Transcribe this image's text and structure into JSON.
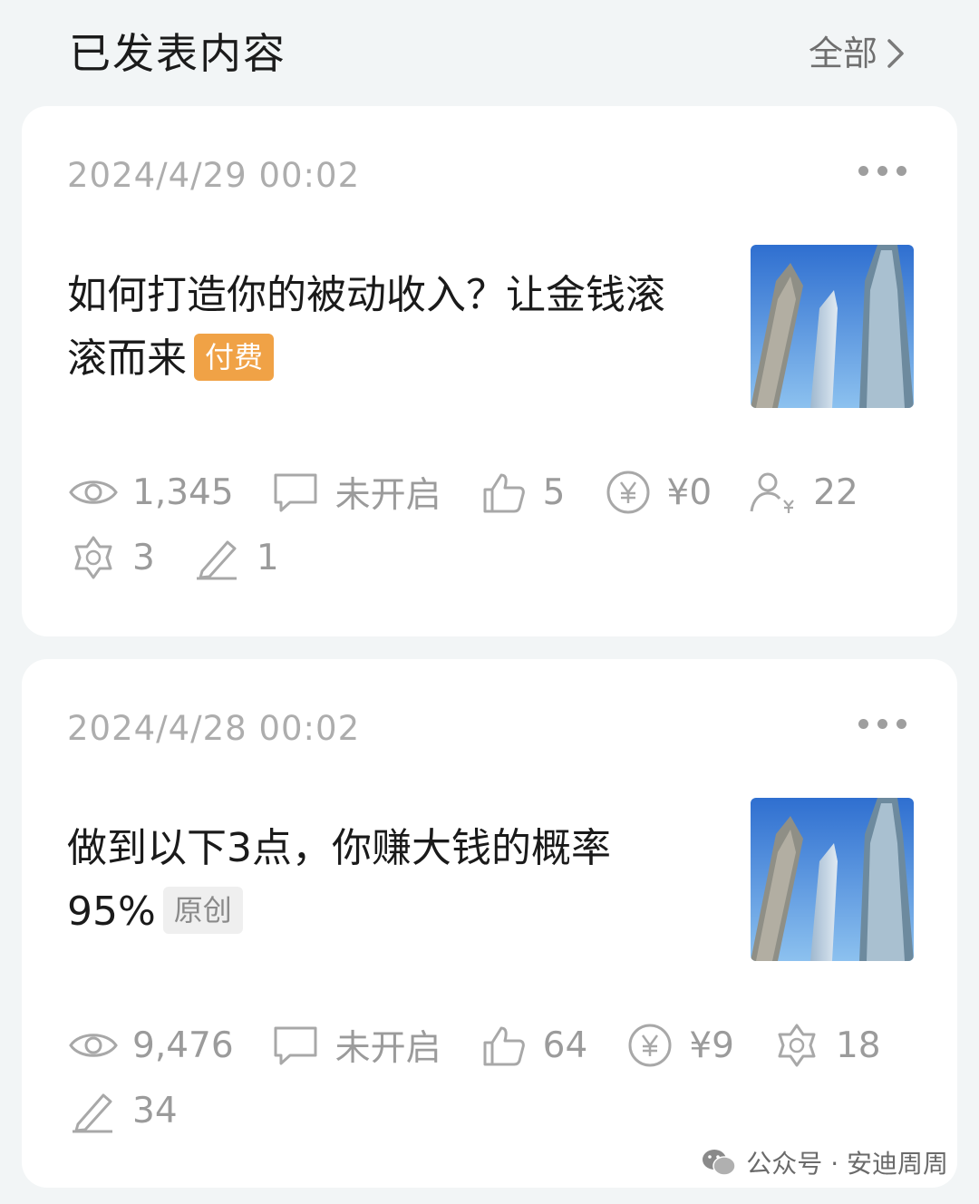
{
  "header": {
    "title": "已发表内容",
    "all_label": "全部"
  },
  "posts": [
    {
      "timestamp": "2024/4/29 00:02",
      "title": "如何打造你的被动收入？让金钱滚滚而来",
      "tag": "付费",
      "thumbnail_icon": "skyscraper-photo",
      "stats": {
        "views": "1,345",
        "comments": "未开启",
        "likes": "5",
        "appreciation": "¥0",
        "paid_users": "22",
        "shares": "3",
        "notes": "1"
      }
    },
    {
      "timestamp": "2024/4/28 00:02",
      "title": "做到以下3点，你赚大钱的概率95%",
      "tag": "原创",
      "thumbnail_icon": "skyscraper-photo",
      "stats": {
        "views": "9,476",
        "comments": "未开启",
        "likes": "64",
        "appreciation": "¥9",
        "shares": "18",
        "notes": "34"
      }
    }
  ],
  "watermark": {
    "text": "公众号 · 安迪周周",
    "icon": "wechat-icon"
  },
  "colors": {
    "background": "#f2f5f6",
    "paid_tag": "#f0a246",
    "original_tag_bg": "#efefef",
    "stat_gray": "#9b9b9b"
  }
}
